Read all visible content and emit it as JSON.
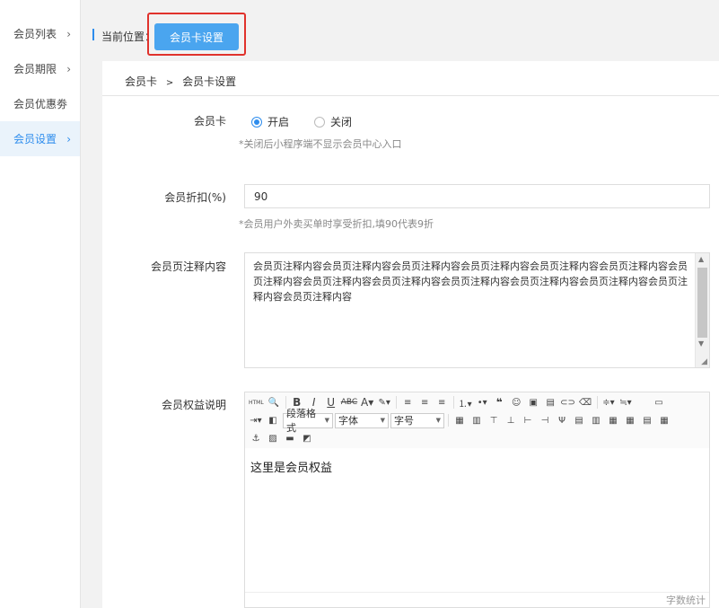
{
  "sidebar": {
    "items": [
      {
        "label": "会员列表",
        "chevron": "›"
      },
      {
        "label": "会员期限",
        "chevron": "›"
      },
      {
        "label": "会员优惠劵"
      },
      {
        "label": "会员设置",
        "chevron": "›",
        "active": true
      }
    ]
  },
  "header": {
    "location_label": "当前位置：",
    "current_button": "会员卡设置"
  },
  "breadcrumb": {
    "parent": "会员卡",
    "separator": ">",
    "current": "会员卡设置"
  },
  "form": {
    "card": {
      "label": "会员卡",
      "options": [
        "开启",
        "关闭"
      ],
      "selected": "开启",
      "hint": "*关闭后小程序端不显示会员中心入口"
    },
    "discount": {
      "label": "会员折扣(%)",
      "value": "90",
      "hint": "*会员用户外卖买单时享受折扣,填90代表9折"
    },
    "page_note": {
      "label": "会员页注释内容",
      "value": "会员页注释内容会员页注释内容会员页注释内容会员页注释内容会员页注释内容会员页注释内容会员页注释内容会员页注释内容会员页注释内容会员页注释内容会员页注释内容会员页注释内容会员页注释内容会员页注释内容"
    },
    "rights": {
      "label": "会员权益说明",
      "content": "这里是会员权益",
      "toolbar": {
        "html": "HTML",
        "paragraph_select": "段落格式",
        "font_select": "字体",
        "size_select": "字号"
      },
      "word_count": "字数统计"
    }
  }
}
